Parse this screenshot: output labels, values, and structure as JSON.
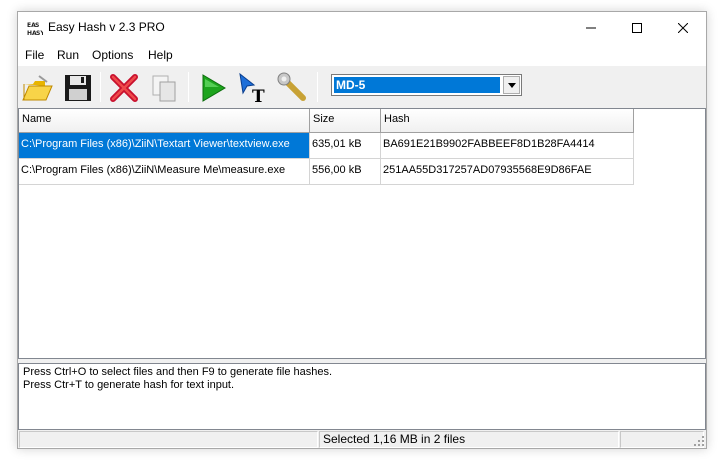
{
  "window": {
    "title": "Easy Hash v 2.3 PRO",
    "icon": "easy-hash-app-icon",
    "controls": {
      "minimize": "minimize-icon",
      "maximize": "maximize-icon",
      "close": "close-icon"
    }
  },
  "menu": [
    "File",
    "Run",
    "Options",
    "Help"
  ],
  "toolbar": {
    "tools": [
      {
        "name": "open-files",
        "icon": "folder-open-icon"
      },
      {
        "name": "save",
        "icon": "floppy-disk-icon"
      },
      {
        "name": "remove",
        "icon": "red-x-icon"
      },
      {
        "name": "copy",
        "icon": "copy-pages-icon"
      },
      {
        "name": "generate-hash",
        "icon": "green-play-icon"
      },
      {
        "name": "hash-text",
        "icon": "cursor-text-icon"
      },
      {
        "name": "settings",
        "icon": "wrench-icon"
      }
    ],
    "algorithm": {
      "selected": "MD-5"
    }
  },
  "list": {
    "columns": [
      "Name",
      "Size",
      "Hash"
    ],
    "rows": [
      {
        "name": "C:\\Program Files (x86)\\ZiiN\\Textart Viewer\\textview.exe",
        "size": "635,01 kB",
        "hash": "BA691E21B9902FABBEEF8D1B28FA4414",
        "selected": true
      },
      {
        "name": "C:\\Program Files (x86)\\ZiiN\\Measure Me\\measure.exe",
        "size": "556,00 kB",
        "hash": "251AA55D317257AD07935568E9D86FAE",
        "selected": false
      }
    ]
  },
  "log": {
    "lines": [
      "Press Ctrl+O to select files and then F9 to generate file hashes.",
      "Press Ctr+T to generate hash for text input."
    ]
  },
  "status": {
    "left": "",
    "middle": "Selected 1,16 MB in 2 files",
    "right": ""
  },
  "colors": {
    "selection": "#0078d7",
    "window_bg": "#f0f0f0",
    "close_red": "#d63a2f"
  }
}
